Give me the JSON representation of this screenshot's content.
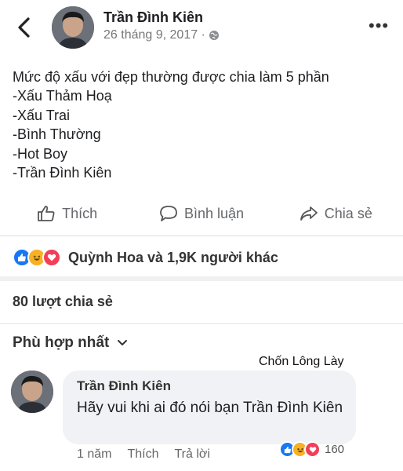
{
  "colors": {
    "like_blue": "#1877f2",
    "haha_yellow": "#f7b125",
    "love_red": "#f33e58",
    "muted_text": "#65676b"
  },
  "header": {
    "back_icon": "chevron-left-icon",
    "author": "Trần Đình Kiên",
    "date": "26 tháng 9, 2017 ·",
    "privacy_icon": "globe-icon",
    "more_icon": "ellipsis-icon"
  },
  "post": {
    "lines": [
      "Mức độ xấu với đẹp thường được chia làm 5 phần",
      "-Xấu Thảm Hoạ",
      "-Xấu Trai",
      "-Bình Thường",
      "-Hot Boy",
      "-Trần Đình Kiên"
    ]
  },
  "actions": {
    "like": "Thích",
    "comment": "Bình luận",
    "share": "Chia sẻ"
  },
  "reactions": {
    "icons": [
      "like-icon",
      "haha-icon",
      "love-icon"
    ],
    "text": "Quỳnh Hoa và 1,9K người khác"
  },
  "shares_text": "80 lượt chia sẻ",
  "sort_label": "Phù hợp nhất",
  "watermark": "Chốn Lông Lày",
  "comment": {
    "author": "Trần Đình Kiên",
    "text": "Hãy vui khi ai đó nói bạn Trần Đình Kiên",
    "time": "1 năm",
    "like": "Thích",
    "reply": "Trả lời",
    "reaction_count": "160"
  }
}
